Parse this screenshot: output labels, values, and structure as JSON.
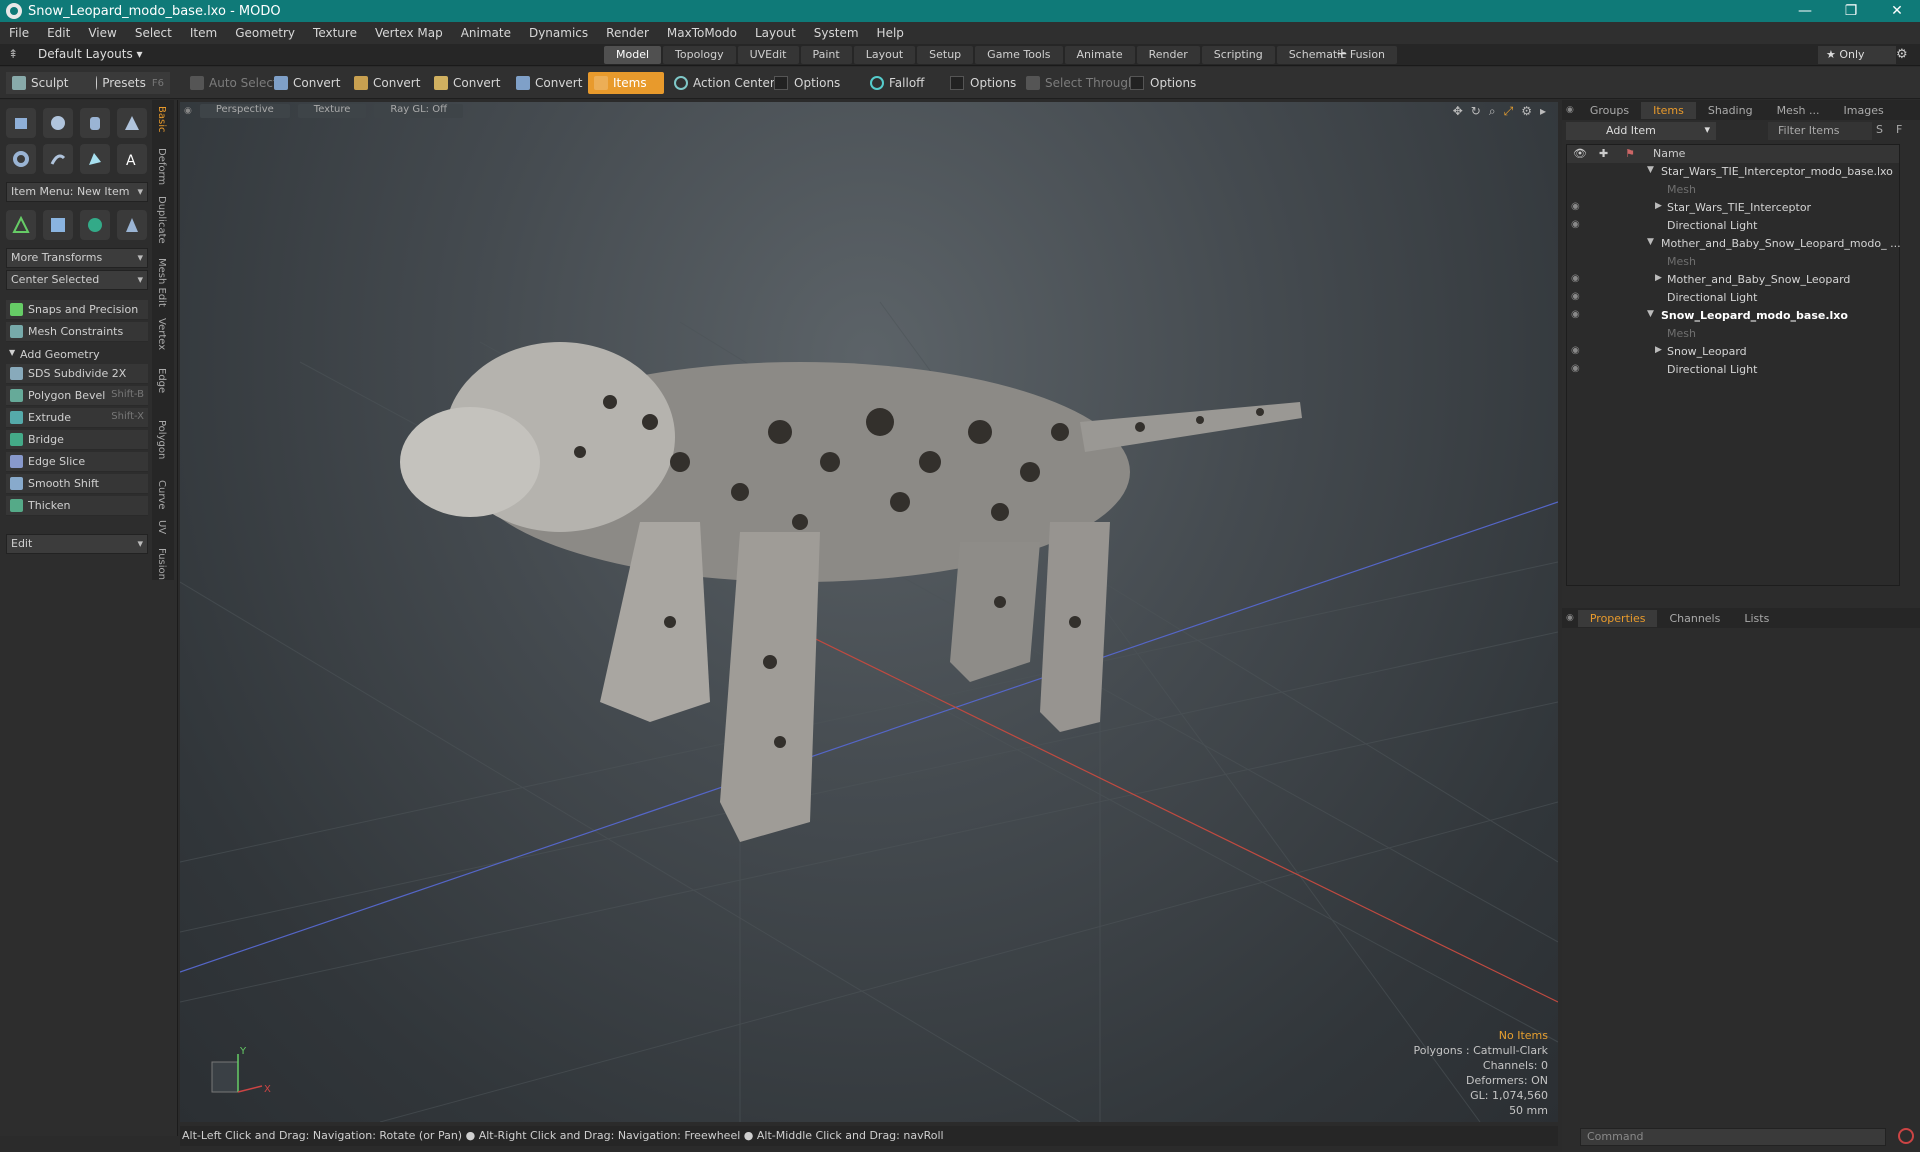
{
  "window": {
    "title": "Snow_Leopard_modo_base.lxo - MODO",
    "minimize": "—",
    "maximize": "❐",
    "close": "✕"
  },
  "menu": [
    "File",
    "Edit",
    "View",
    "Select",
    "Item",
    "Geometry",
    "Texture",
    "Vertex Map",
    "Animate",
    "Dynamics",
    "Render",
    "MaxToModo",
    "Layout",
    "System",
    "Help"
  ],
  "layoutbar": {
    "default_layouts": "Default Layouts ▾",
    "tabs": [
      "Model",
      "Topology",
      "UVEdit",
      "Paint",
      "Layout",
      "Setup",
      "Game Tools",
      "Animate",
      "Render",
      "Scripting",
      "Schematic Fusion"
    ],
    "active_tab": "Model",
    "add": "+",
    "only": "★ Only",
    "gear": "⚙"
  },
  "toolbar": {
    "sculpt": "Sculpt",
    "presets": "Presets",
    "presets_key": "F6",
    "auto_select": "Auto Select",
    "convert": "Convert",
    "items": "Items",
    "action_center": "Action Center",
    "options": "Options",
    "falloff": "Falloff",
    "select_through": "Select Through"
  },
  "left": {
    "item_menu": "Item Menu: New Item",
    "more_transforms": "More Transforms",
    "center_selected": "Center Selected",
    "snaps": "Snaps and Precision",
    "mesh_constraints": "Mesh Constraints",
    "add_geometry": "Add Geometry",
    "tools": [
      {
        "label": "SDS Subdivide 2X",
        "key": ""
      },
      {
        "label": "Polygon Bevel",
        "key": "Shift-B"
      },
      {
        "label": "Extrude",
        "key": "Shift-X"
      },
      {
        "label": "Bridge",
        "key": ""
      },
      {
        "label": "Edge Slice",
        "key": ""
      },
      {
        "label": "Smooth Shift",
        "key": ""
      },
      {
        "label": "Thicken",
        "key": ""
      }
    ],
    "edit": "Edit",
    "vtabs": [
      "Basic",
      "Deform",
      "Duplicate",
      "Mesh Edit",
      "Vertex",
      "Edge",
      "Polygon",
      "Curve",
      "UV",
      "Fusion"
    ]
  },
  "viewport": {
    "perspective": "Perspective",
    "texture": "Texture",
    "raygl": "Ray GL: Off",
    "stats": {
      "no_items": "No Items",
      "polygons": "Polygons : Catmull-Clark",
      "channels": "Channels: 0",
      "deformers": "Deformers: ON",
      "gl": "GL: 1,074,560",
      "lens": "50 mm"
    },
    "axis_y": "Y",
    "axis_x": "X"
  },
  "status": "Alt-Left Click and Drag: Navigation: Rotate (or Pan) ● Alt-Right Click and Drag: Navigation: Freewheel ● Alt-Middle Click and Drag: navRoll",
  "right": {
    "top_tabs": [
      "Groups",
      "Items",
      "Shading",
      "Mesh ...",
      "Images"
    ],
    "active_top": "Items",
    "add_item": "Add Item",
    "filter": "Filter Items",
    "filter_s": "S",
    "filter_f": "F",
    "name_col": "Name",
    "items": [
      {
        "label": "Star_Wars_TIE_Interceptor_modo_base.lxo",
        "indent": 0,
        "arrow": "▼",
        "dim": false,
        "bold": false
      },
      {
        "label": "Mesh",
        "indent": 2,
        "arrow": "",
        "dim": true,
        "bold": false
      },
      {
        "label": "Star_Wars_TIE_Interceptor",
        "indent": 2,
        "arrow": "▶",
        "dim": false,
        "bold": false
      },
      {
        "label": "Directional Light",
        "indent": 2,
        "arrow": "",
        "dim": false,
        "bold": false
      },
      {
        "label": "Mother_and_Baby_Snow_Leopard_modo_ ...",
        "indent": 0,
        "arrow": "▼",
        "dim": false,
        "bold": false
      },
      {
        "label": "Mesh",
        "indent": 2,
        "arrow": "",
        "dim": true,
        "bold": false
      },
      {
        "label": "Mother_and_Baby_Snow_Leopard",
        "indent": 2,
        "arrow": "▶",
        "dim": false,
        "bold": false
      },
      {
        "label": "Directional Light",
        "indent": 2,
        "arrow": "",
        "dim": false,
        "bold": false
      },
      {
        "label": "Snow_Leopard_modo_base.lxo",
        "indent": 0,
        "arrow": "▼",
        "dim": false,
        "bold": true
      },
      {
        "label": "Mesh",
        "indent": 2,
        "arrow": "",
        "dim": true,
        "bold": false
      },
      {
        "label": "Snow_Leopard",
        "indent": 2,
        "arrow": "▶",
        "dim": false,
        "bold": false
      },
      {
        "label": "Directional Light",
        "indent": 2,
        "arrow": "",
        "dim": false,
        "bold": false
      }
    ],
    "bottom_tabs": [
      "Properties",
      "Channels",
      "Lists"
    ],
    "active_bottom": "Properties",
    "command": "Command"
  },
  "colors": {
    "accent": "#e89a2c",
    "titlebar": "#0f7a78"
  }
}
